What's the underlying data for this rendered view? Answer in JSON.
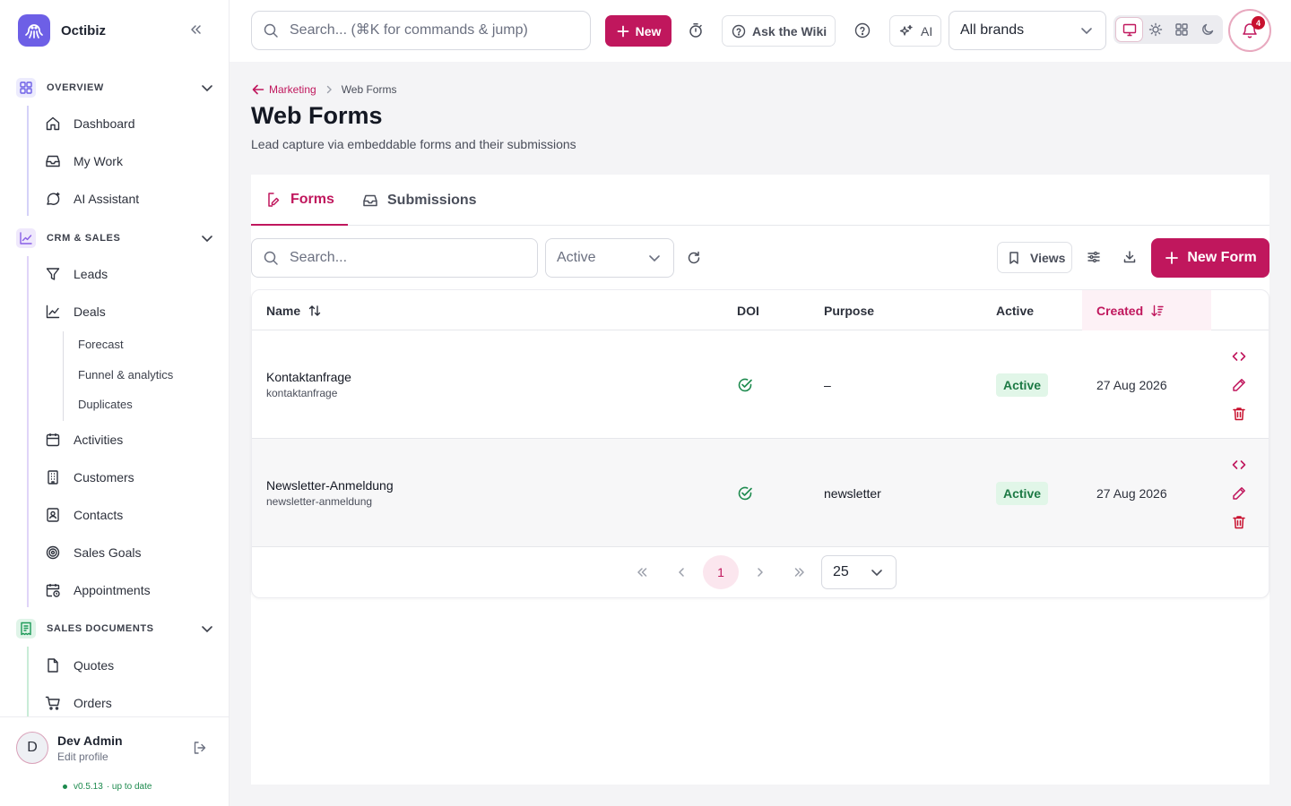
{
  "app": {
    "name": "Octibiz"
  },
  "sidebar": {
    "sections": [
      {
        "label": "OVERVIEW",
        "color": "#6d5fe6",
        "items": [
          "Dashboard",
          "My Work",
          "AI Assistant"
        ]
      },
      {
        "label": "CRM & SALES",
        "color": "#8a5fe6",
        "items": [
          "Leads",
          "Deals",
          "Activities",
          "Customers",
          "Contacts",
          "Sales Goals",
          "Appointments"
        ],
        "deals_subitems": [
          "Forecast",
          "Funnel & analytics",
          "Duplicates"
        ]
      },
      {
        "label": "SALES DOCUMENTS",
        "color": "#1d9a58",
        "items": [
          "Quotes",
          "Orders"
        ]
      }
    ],
    "profile": {
      "initial": "D",
      "name": "Dev Admin",
      "edit": "Edit profile",
      "version": "v0.5.13",
      "status": "· up to date"
    }
  },
  "topbar": {
    "search_placeholder": "Search... (⌘K for commands & jump)",
    "new_label": "New",
    "wiki_label": "Ask the Wiki",
    "ai_label": "AI",
    "brand_value": "All brands",
    "notifications_count": "4",
    "accent": "#c0175d"
  },
  "page": {
    "breadcrumb": {
      "parent": "Marketing",
      "current": "Web Forms"
    },
    "title": "Web Forms",
    "subtitle": "Lead capture via embeddable forms and their submissions",
    "tabs": [
      "Forms",
      "Submissions"
    ],
    "filters": {
      "search_placeholder": "Search...",
      "status_value": "Active",
      "views_label": "Views",
      "new_form_label": "New Form"
    },
    "table": {
      "columns": [
        "Name",
        "DOI",
        "Purpose",
        "Active",
        "Created"
      ],
      "rows": [
        {
          "name": "Kontaktanfrage",
          "slug": "kontaktanfrage",
          "purpose": "–",
          "active": "Active",
          "created": "27 Aug 2026"
        },
        {
          "name": "Newsletter-Anmeldung",
          "slug": "newsletter-anmeldung",
          "purpose": "newsletter",
          "active": "Active",
          "created": "27 Aug 2026"
        }
      ]
    },
    "pagination": {
      "current_page": "1",
      "per_page": "25"
    }
  }
}
